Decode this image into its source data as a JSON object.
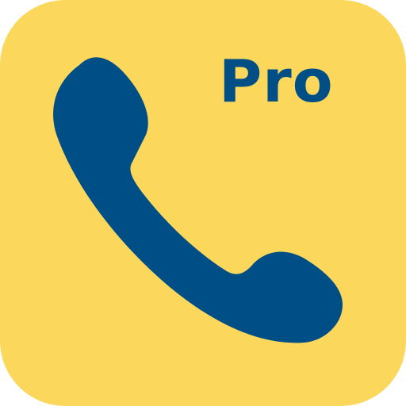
{
  "icon": {
    "badge_text": "Pro",
    "icon_name": "phone-handset-icon",
    "colors": {
      "background": "#FBD85C",
      "foreground": "#004E86",
      "page": "#FFFFFF"
    }
  }
}
